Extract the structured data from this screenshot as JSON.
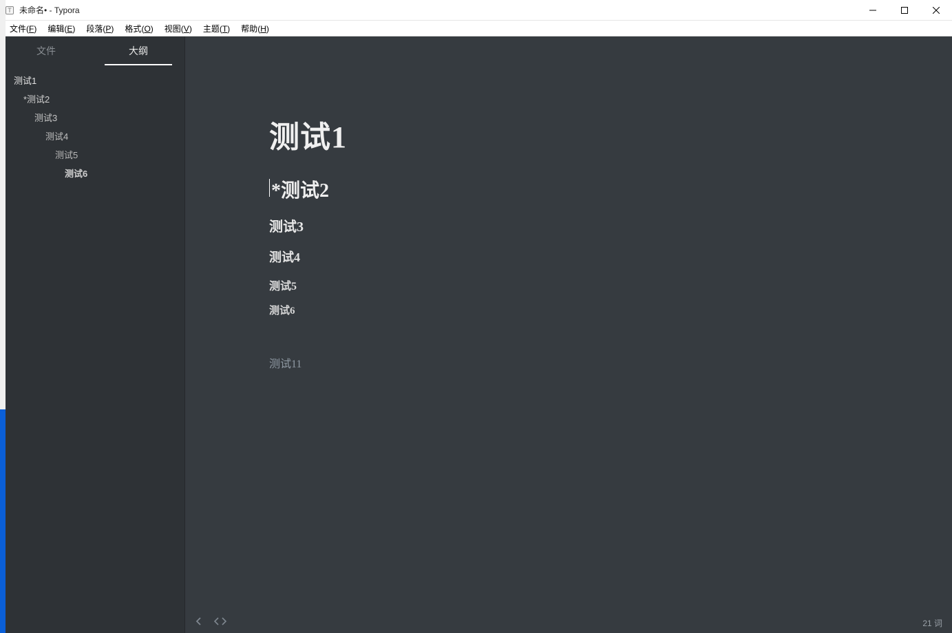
{
  "window": {
    "title": "未命名• - Typora",
    "app_icon_letter": "T"
  },
  "menu": [
    {
      "label": "文件",
      "mn": "F"
    },
    {
      "label": "编辑",
      "mn": "E"
    },
    {
      "label": "段落",
      "mn": "P"
    },
    {
      "label": "格式",
      "mn": "O"
    },
    {
      "label": "视图",
      "mn": "V"
    },
    {
      "label": "主题",
      "mn": "T"
    },
    {
      "label": "帮助",
      "mn": "H"
    }
  ],
  "sidebar": {
    "tabs": {
      "files": "文件",
      "outline": "大纲",
      "active": "outline"
    },
    "outline": [
      {
        "label": "测试1",
        "level": 1
      },
      {
        "label": "*测试2",
        "level": 2
      },
      {
        "label": "测试3",
        "level": 3
      },
      {
        "label": "测试4",
        "level": 4
      },
      {
        "label": "测试5",
        "level": 5
      },
      {
        "label": "测试6",
        "level": 6
      }
    ]
  },
  "document": {
    "h1": "测试1",
    "h2": "*测试2",
    "h3": "测试3",
    "h4": "测试4",
    "h5": "测试5",
    "h6": "测试6",
    "p": "测试11"
  },
  "status": {
    "word_count": "21 词"
  }
}
